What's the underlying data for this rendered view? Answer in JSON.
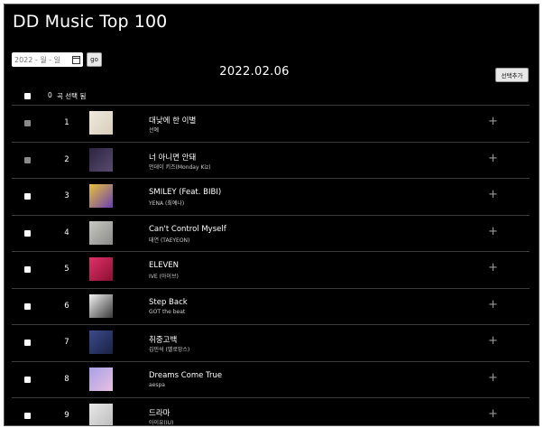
{
  "app": {
    "title": "DD Music Top 100"
  },
  "controls": {
    "date_placeholder": "2022 - 월 - 일",
    "go_label": "go",
    "chart_date": "2022.02.06",
    "add_selected_label": "선택추가"
  },
  "selection": {
    "count": "0",
    "text": "곡 선택 됨"
  },
  "colors": {
    "background": "#000000",
    "text": "#ffffff",
    "divider": "#3a3a3a",
    "plus": "#9a9a9a"
  },
  "songs": [
    {
      "rank": "1",
      "title": "대낮에 한 이별",
      "artist": "선예",
      "checkbox": "gray",
      "cover": [
        "#efe9de",
        "#d8cdb8"
      ]
    },
    {
      "rank": "2",
      "title": "너 아니면 안돼",
      "artist": "먼데이 키즈(Monday Kiz)",
      "checkbox": "gray",
      "cover": [
        "#2c2440",
        "#5a4a6e"
      ]
    },
    {
      "rank": "3",
      "title": "SMILEY (Feat. BIBI)",
      "artist": "YENA (최예나)",
      "checkbox": "white",
      "cover": [
        "#e8c23a",
        "#6a3fb0"
      ]
    },
    {
      "rank": "4",
      "title": "Can't Control Myself",
      "artist": "태연 (TAEYEON)",
      "checkbox": "white",
      "cover": [
        "#c8c8c4",
        "#8a8a86"
      ]
    },
    {
      "rank": "5",
      "title": "ELEVEN",
      "artist": "IVE (아이브)",
      "checkbox": "white",
      "cover": [
        "#e0306a",
        "#8a1030"
      ]
    },
    {
      "rank": "6",
      "title": "Step Back",
      "artist": "GOT the beat",
      "checkbox": "white",
      "cover": [
        "#f2f2f2",
        "#3a3a3a"
      ]
    },
    {
      "rank": "7",
      "title": "취중고백",
      "artist": "김민석 (멜로망스)",
      "checkbox": "white",
      "cover": [
        "#3a4a8a",
        "#1a2244"
      ]
    },
    {
      "rank": "8",
      "title": "Dreams Come True",
      "artist": "aespa",
      "checkbox": "white",
      "cover": [
        "#a8a0e8",
        "#e8c0e0"
      ]
    },
    {
      "rank": "9",
      "title": "드라마",
      "artist": "아이유(IU)",
      "checkbox": "white",
      "cover": [
        "#e8e8e8",
        "#bcbcbc"
      ]
    }
  ]
}
